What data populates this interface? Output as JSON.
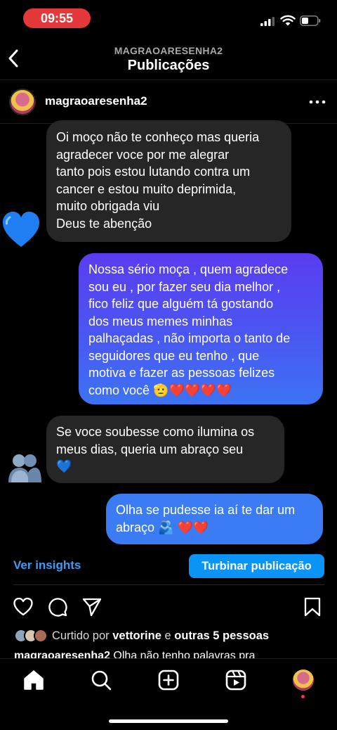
{
  "status_bar": {
    "time": "09:55"
  },
  "header": {
    "subtitle": "MAGRAOARESENHA2",
    "title": "Publicações"
  },
  "post": {
    "username": "magraoaresenha2"
  },
  "messages": [
    {
      "from": "them",
      "lines": [
        "Oi moço não te conheço mas queria",
        "agradecer voce por me alegrar",
        "tanto pois estou lutando contra um",
        "cancer e estou muito deprimida,",
        "muito obrigada viu",
        "Deus te abenção"
      ],
      "reaction_emoji": "💙"
    },
    {
      "from": "me",
      "lines": [
        "Nossa sério moça , quem agradece",
        "sou eu , por fazer seu dia melhor ,",
        "fico feliz que alguém tá gostando",
        "dos meus memes minhas",
        "palhaçadas , não importa o tanto de",
        "seguidores que eu tenho , que",
        "motiva e fazer as pessoas felizes"
      ],
      "last_line": "como você 🫡❤️❤️❤️❤️"
    },
    {
      "from": "them",
      "lines": [
        "Se voce soubesse como ilumina os",
        "meus dias, queria um abraço seu"
      ],
      "last_line": "💙",
      "reaction_emoji": "🫂"
    },
    {
      "from": "me",
      "lines": [
        "Olha se pudesse ia aí te dar um"
      ],
      "last_line": "abraço 🫂 ❤️❤️"
    }
  ],
  "actions": {
    "insights": "Ver insights",
    "boost": "Turbinar publicação"
  },
  "likes": {
    "prefix": "Curtido por",
    "user": "vettorine",
    "conj": "e",
    "others": "outras 5 pessoas"
  },
  "caption": {
    "user": "magraoaresenha2",
    "text": "Olha não tenho palavras pra"
  },
  "icons": {
    "back": "chevron-left-icon",
    "more": "more-horizontal-icon",
    "like": "heart-outline-icon",
    "comment": "comment-icon",
    "share": "send-icon",
    "save": "bookmark-icon",
    "nav": [
      "home-icon",
      "search-icon",
      "create-icon",
      "reels-icon",
      "profile-avatar"
    ]
  },
  "colors": {
    "accent": "#0a95f6",
    "link": "#3d9bf5",
    "bubble_in": "#262626",
    "bubble_out_top": "#5a3cf0",
    "bubble_out_bottom": "#3c73f4",
    "time_pill": "#e5383b"
  }
}
